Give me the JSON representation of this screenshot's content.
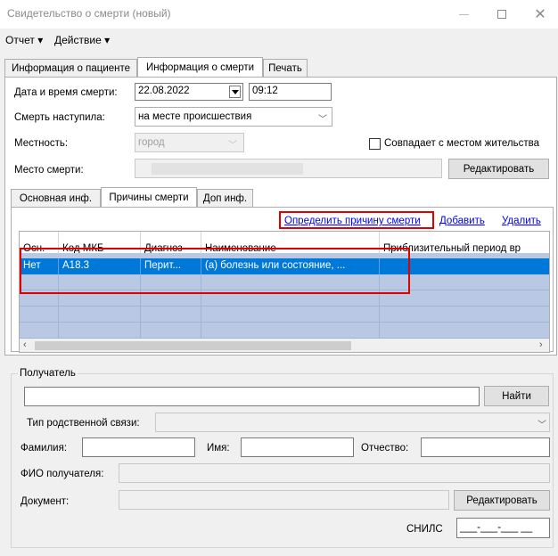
{
  "window": {
    "title": "Свидетельство о смерти (новый)"
  },
  "menu": {
    "report": "Отчет ▾",
    "action": "Действие ▾"
  },
  "main_tabs": [
    "Информация о пациенте",
    "Информация о смерти",
    "Печать"
  ],
  "death_info": {
    "datetime_label": "Дата и время смерти:",
    "date": "22.08.2022",
    "time": "09:12",
    "occurred_label": "Смерть наступила:",
    "occurred_value": "на месте происшествия",
    "locality_label": "Местность:",
    "locality_value": "город",
    "same_residence_label": "Совпадает с местом жительства",
    "place_label": "Место смерти:",
    "edit_button": "Редактировать"
  },
  "sub_tabs": [
    "Основная инф.",
    "Причины смерти",
    "Доп инф."
  ],
  "actions": {
    "determine": "Определить причину смерти",
    "add": "Добавить",
    "delete": "Удалить"
  },
  "grid": {
    "columns": [
      "Осн.",
      "Код МКБ",
      "Диагноз",
      "Наименование",
      "Приблизительный период вр"
    ],
    "rows": [
      [
        "Нет",
        "A18.3",
        "Перит...",
        "(а) болезнь или состояние, ...",
        ""
      ]
    ]
  },
  "recipient": {
    "group_label": "Получатель",
    "find_button": "Найти",
    "relation_label": "Тип родственной связи:",
    "lastname_label": "Фамилия:",
    "firstname_label": "Имя:",
    "patronymic_label": "Отчество:",
    "fio_label": "ФИО получателя:",
    "document_label": "Документ:",
    "edit_button": "Редактировать",
    "snils_label": "СНИЛС",
    "snils_value": "___-___-___ __"
  }
}
